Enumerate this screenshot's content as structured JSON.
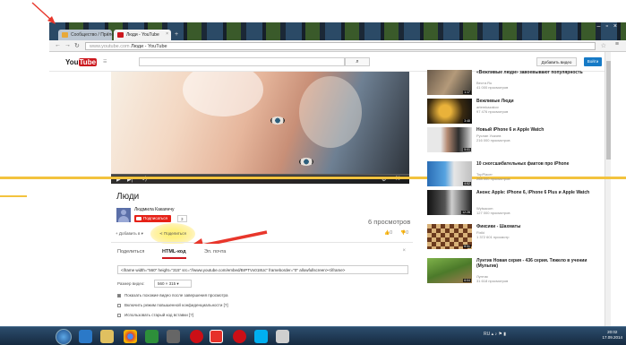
{
  "browser": {
    "tabs": [
      {
        "label": "Сообщество / Прило..."
      },
      {
        "label": "Люди - YouTube"
      }
    ],
    "url_domain": "www.youtube.com",
    "url_title": " Люди - YouTube"
  },
  "youtube": {
    "logo_you": "You",
    "logo_tube": "Tube",
    "guide": "☰",
    "add_video": "Добавить видео",
    "login": "Войти"
  },
  "video": {
    "title": "Люди",
    "channel": "Людмила Какаянчу",
    "subscribe": "Подписаться",
    "sub_count": "3",
    "views": "6 просмотров",
    "add_to": "Добавить в",
    "share": "Поделиться",
    "likes": "0",
    "dislikes": "0",
    "progress": 0.0
  },
  "share_panel": {
    "tabs": [
      "Поделиться",
      "HTML-код",
      "Эл. почта"
    ],
    "active_tab": "HTML-код",
    "embed_code": "<iframe width=\"560\" height=\"315\" src=\"//www.youtube.com/embed/BrPTVx018Uc\" frameborder=\"0\" allowfullscreen></iframe>",
    "size_label": "Размер видео:",
    "size_value": "560 × 315",
    "options": [
      {
        "label": "Показать похожие видео после завершения просмотра",
        "checked": true
      },
      {
        "label": "Включить режим повышенной конфиденциальности [?]",
        "checked": false
      },
      {
        "label": "Использовать старый код вставки [?]",
        "checked": false
      }
    ]
  },
  "related": [
    {
      "title": "«Вежливые люди» завоевывают популярность",
      "channel": "Вести.Ru",
      "views": "41 000 просмотров",
      "duration": "1:17"
    },
    {
      "title": "Вежливые Люди",
      "channel": "artemkazakov",
      "views": "97 476 просмотров",
      "duration": "3:48"
    },
    {
      "title": "Новый iPhone 6 и Apple Watch",
      "channel": "Руслан Усачев",
      "views": "216 000 просмотров",
      "duration": "5:01"
    },
    {
      "title": "10 сногсшибательных фактов про iPhone",
      "channel": "TopPlacer",
      "views": "268 000 просмотров",
      "duration": "4:52"
    },
    {
      "title": "Анонс Apple: iPhone 6, iPhone 6 Plus и Apple Watch",
      "channel": "Wylsacom",
      "views": "127 000 просмотров",
      "duration": "12:28"
    },
    {
      "title": "Фиксики - Шахматы",
      "channel": "Fixiki",
      "views": "1 372 601 просмотр",
      "duration": "6:31"
    },
    {
      "title": "Лунтик Новая серия - 436 серия. Тяжело в учении (Мультик)",
      "channel": "Лунтик",
      "views": "31 618 просмотров",
      "duration": "6:04"
    }
  ],
  "taskbar": {
    "lang": "RU",
    "time": "20:02",
    "date": "17.09.2014"
  },
  "colors": {
    "youtube_red": "#cc181e",
    "highlight_line": "#f3c33e",
    "annotation_arrow": "#e8362b",
    "login_blue": "#167ac6"
  }
}
